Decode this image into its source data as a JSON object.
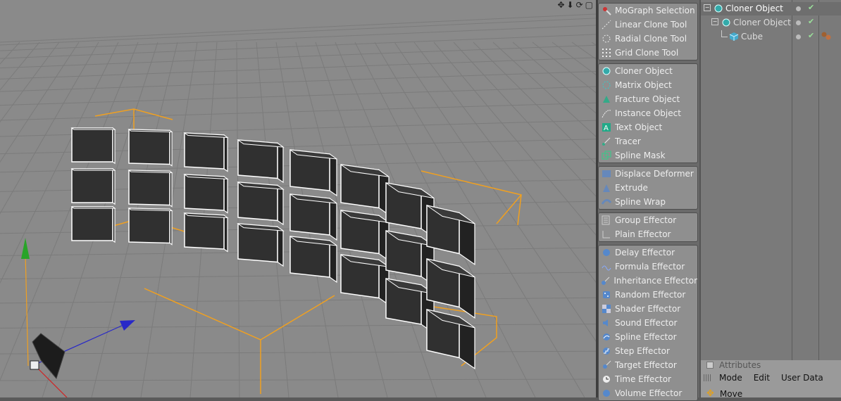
{
  "viewport": {
    "nav_icons": [
      "move-view-icon",
      "zoom-view-icon",
      "rotate-view-icon",
      "maximize-view-icon"
    ],
    "nav_glyphs": [
      "✥",
      "⬇",
      "⟳",
      "▢"
    ],
    "colors": {
      "background": "#8a8a8a",
      "grid": "#7b7b7b",
      "selection_bracket": "#f0a020",
      "cube_face": "#303030",
      "cube_edge": "#ffffff",
      "axis_x": "#d22020",
      "axis_y": "#28a428",
      "axis_z": "#2828c8"
    }
  },
  "mograph_menu": {
    "groups": [
      {
        "items": [
          {
            "label": "MoGraph Selection",
            "icon": "mograph-selection-icon"
          },
          {
            "label": "Linear Clone Tool",
            "icon": "linear-clone-icon"
          },
          {
            "label": "Radial Clone Tool",
            "icon": "radial-clone-icon"
          },
          {
            "label": "Grid Clone Tool",
            "icon": "grid-clone-icon"
          }
        ]
      },
      {
        "items": [
          {
            "label": "Cloner Object",
            "icon": "cloner-icon"
          },
          {
            "label": "Matrix Object",
            "icon": "matrix-icon"
          },
          {
            "label": "Fracture Object",
            "icon": "fracture-icon"
          },
          {
            "label": "Instance Object",
            "icon": "instance-icon"
          },
          {
            "label": "Text Object",
            "icon": "text-icon"
          },
          {
            "label": "Tracer",
            "icon": "tracer-icon"
          },
          {
            "label": "Spline Mask",
            "icon": "spline-mask-icon"
          }
        ]
      },
      {
        "items": [
          {
            "label": "Displace Deformer",
            "icon": "displace-icon"
          },
          {
            "label": "Extrude",
            "icon": "extrude-icon"
          },
          {
            "label": "Spline Wrap",
            "icon": "spline-wrap-icon"
          }
        ]
      },
      {
        "items": [
          {
            "label": "Group Effector",
            "icon": "group-effector-icon"
          },
          {
            "label": "Plain Effector",
            "icon": "plain-effector-icon"
          }
        ]
      },
      {
        "items": [
          {
            "label": "Delay Effector",
            "icon": "delay-effector-icon"
          },
          {
            "label": "Formula Effector",
            "icon": "formula-effector-icon"
          },
          {
            "label": "Inheritance Effector",
            "icon": "inheritance-effector-icon"
          },
          {
            "label": "Random Effector",
            "icon": "random-effector-icon"
          },
          {
            "label": "Shader Effector",
            "icon": "shader-effector-icon"
          },
          {
            "label": "Sound Effector",
            "icon": "sound-effector-icon"
          },
          {
            "label": "Spline Effector",
            "icon": "spline-effector-icon"
          },
          {
            "label": "Step Effector",
            "icon": "step-effector-icon"
          },
          {
            "label": "Target Effector",
            "icon": "target-effector-icon"
          },
          {
            "label": "Time Effector",
            "icon": "time-effector-icon"
          },
          {
            "label": "Volume Effector",
            "icon": "volume-effector-icon"
          }
        ]
      }
    ]
  },
  "object_manager": {
    "objects": [
      {
        "name": "Cloner Object",
        "icon": "cloner-icon",
        "depth": 0,
        "selected": true
      },
      {
        "name": "Cloner Object",
        "icon": "cloner-icon",
        "depth": 1,
        "selected": false
      },
      {
        "name": "Cube",
        "icon": "cube-icon",
        "depth": 2,
        "selected": false
      }
    ]
  },
  "attributes": {
    "title": "Attributes",
    "menu": [
      "Mode",
      "Edit",
      "User Data"
    ],
    "active_tool": "Move"
  }
}
